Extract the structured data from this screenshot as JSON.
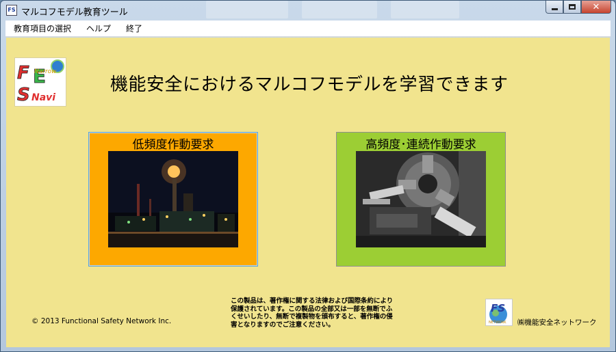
{
  "window": {
    "title": "マルコフモデル教育ツール",
    "app_icon_text": "FS"
  },
  "menu": {
    "items": [
      "教育項目の選択",
      "ヘルプ",
      "終了"
    ]
  },
  "main": {
    "headline": "機能安全におけるマルコフモデルを学習できます",
    "logo_text": {
      "f": "F",
      "s": "S",
      "e": "E",
      "narrow": "Narrow",
      "navi": "Navi"
    },
    "panels": [
      {
        "title": "低頻度作動要求",
        "image": "factory-night-photo"
      },
      {
        "title": "高頻度･連続作動要求",
        "image": "lathe-machine-photo"
      }
    ],
    "notice": "この製品は、著作権に関する法律および国際条約により保護されています。この製品の全部又は一部を無断でふくせいしたり、無断で複製物を頒布すると、著作権の侵害となりますのでご注意ください。",
    "copyright": "© 2013 Functional Safety Network Inc.",
    "org_name": "㈱機能安全ネットワーク",
    "org_logo_text": {
      "fs": "FS",
      "network": "NETWORK"
    }
  },
  "colors": {
    "client_bg": "#f1e48e",
    "low_panel": "#fda800",
    "high_panel": "#9cce34"
  }
}
